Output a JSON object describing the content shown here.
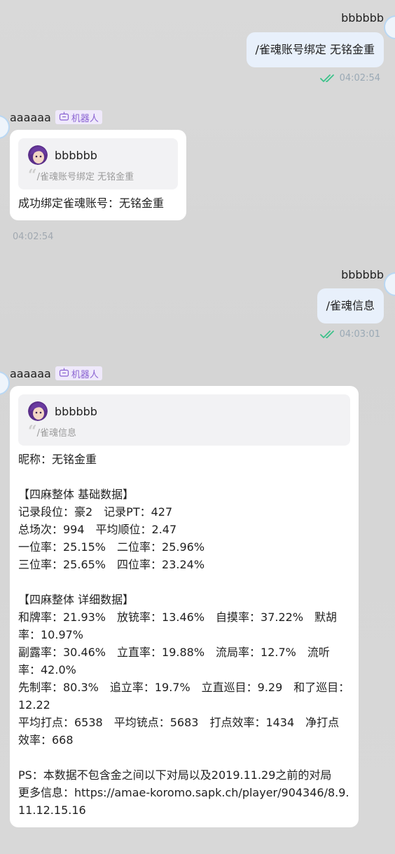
{
  "messages": [
    {
      "sender": "bbbbbb",
      "text": "/雀魂账号绑定 无铭金重",
      "time": "04:02:54"
    },
    {
      "sender": "aaaaaa",
      "badge": "机器人",
      "quote": {
        "sender": "bbbbbb",
        "text": "/雀魂账号绑定 无铭金重"
      },
      "text": "成功绑定雀魂账号：无铭金重",
      "time": "04:02:54"
    },
    {
      "sender": "bbbbbb",
      "text": "/雀魂信息",
      "time": "04:03:01"
    },
    {
      "sender": "aaaaaa",
      "badge": "机器人",
      "quote": {
        "sender": "bbbbbb",
        "text": "/雀魂信息"
      },
      "text": "昵称：无铭金重\n\n【四麻整体 基础数据】\n记录段位：豪2　记录PT：427\n总场次：994　平均顺位：2.47\n一位率：25.15%　二位率：25.96%\n三位率：25.65%　四位率：23.24%\n\n【四麻整体 详细数据】\n和牌率：21.93%　放铳率：13.46%　自摸率：37.22%　默胡率：10.97%\n副露率：30.46%　立直率：19.88%　流局率：12.7%　流听率：42.0%\n先制率：80.3%　追立率：19.7%　立直巡目：9.29　和了巡目：12.22\n平均打点：6538　平均铳点：5683　打点效率：1434　净打点效率：668\n\nPS：本数据不包含金之间以下对局以及2019.11.29之前的对局\n更多信息：https://amae-koromo.sapk.ch/player/904346/8.9.11.12.15.16"
    }
  ]
}
